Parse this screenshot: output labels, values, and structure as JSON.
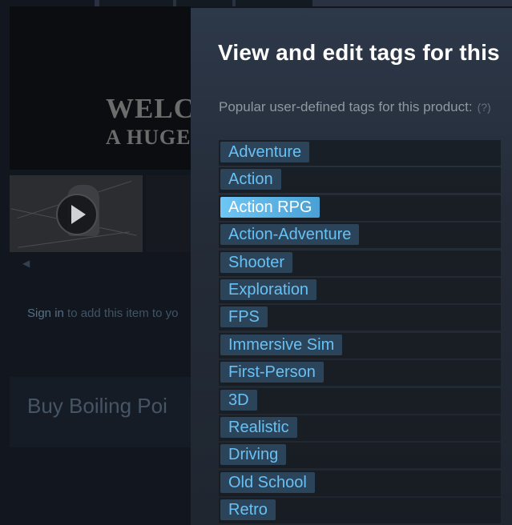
{
  "background": {
    "hero_text_line1": "WELC",
    "hero_text_line2": "A HUGE",
    "signin_link": "Sign in",
    "signin_rest": " to add this item to yo",
    "buy_title": "Buy Boiling Poi"
  },
  "modal": {
    "title": "View and edit tags for this",
    "subtitle": "Popular user-defined tags for this product:",
    "help_hint": "(?)",
    "tags": [
      {
        "label": "Adventure",
        "selected": false
      },
      {
        "label": "Action",
        "selected": false
      },
      {
        "label": "Action RPG",
        "selected": true
      },
      {
        "label": "Action-Adventure",
        "selected": false
      },
      {
        "label": "Shooter",
        "selected": false
      },
      {
        "label": "Exploration",
        "selected": false
      },
      {
        "label": "FPS",
        "selected": false
      },
      {
        "label": "Immersive Sim",
        "selected": false
      },
      {
        "label": "First-Person",
        "selected": false
      },
      {
        "label": "3D",
        "selected": false
      },
      {
        "label": "Realistic",
        "selected": false
      },
      {
        "label": "Driving",
        "selected": false
      },
      {
        "label": "Old School",
        "selected": false
      },
      {
        "label": "Retro",
        "selected": false
      }
    ]
  },
  "colors": {
    "tag_bg": "#2c4459",
    "tag_text": "#67c1f5",
    "tag_selected_bg": "#6ec6f5",
    "tag_selected_text": "#ffffff",
    "modal_title": "#ffffff",
    "modal_subtitle": "#8f98a0"
  },
  "icons": {
    "play": "play-icon"
  }
}
